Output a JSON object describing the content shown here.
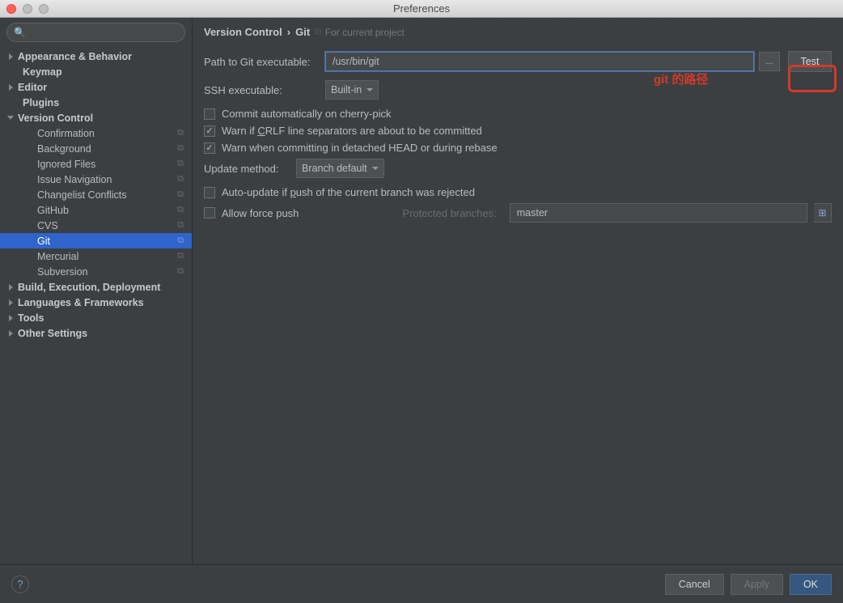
{
  "window": {
    "title": "Preferences"
  },
  "search": {
    "placeholder": ""
  },
  "tree": {
    "items": [
      {
        "label": "Appearance & Behavior",
        "bold": true,
        "arrow": "right",
        "indent": 0
      },
      {
        "label": "Keymap",
        "bold": true,
        "indent": 1,
        "noarrow": true
      },
      {
        "label": "Editor",
        "bold": true,
        "arrow": "right",
        "indent": 0
      },
      {
        "label": "Plugins",
        "bold": true,
        "indent": 1,
        "noarrow": true
      },
      {
        "label": "Version Control",
        "bold": true,
        "arrow": "down",
        "indent": 0
      },
      {
        "label": "Confirmation",
        "indent": 2,
        "copy": true
      },
      {
        "label": "Background",
        "indent": 2,
        "copy": true
      },
      {
        "label": "Ignored Files",
        "indent": 2,
        "copy": true
      },
      {
        "label": "Issue Navigation",
        "indent": 2,
        "copy": true
      },
      {
        "label": "Changelist Conflicts",
        "indent": 2,
        "copy": true
      },
      {
        "label": "GitHub",
        "indent": 2,
        "copy": true
      },
      {
        "label": "CVS",
        "indent": 2,
        "copy": true
      },
      {
        "label": "Git",
        "indent": 2,
        "copy": true,
        "selected": true
      },
      {
        "label": "Mercurial",
        "indent": 2,
        "copy": true
      },
      {
        "label": "Subversion",
        "indent": 2,
        "copy": true
      },
      {
        "label": "Build, Execution, Deployment",
        "bold": true,
        "arrow": "right",
        "indent": 0
      },
      {
        "label": "Languages & Frameworks",
        "bold": true,
        "arrow": "right",
        "indent": 0
      },
      {
        "label": "Tools",
        "bold": true,
        "arrow": "right",
        "indent": 0
      },
      {
        "label": "Other Settings",
        "bold": true,
        "arrow": "right",
        "indent": 0
      }
    ]
  },
  "breadcrumb": {
    "root": "Version Control",
    "sep": "›",
    "leaf": "Git",
    "project": "For current project"
  },
  "form": {
    "path_label": "Path to Git executable:",
    "path_value": "/usr/bin/git",
    "browse": "...",
    "test": "Test",
    "ssh_label": "SSH executable:",
    "ssh_value": "Built-in",
    "cb_cherry": "Commit automatically on cherry-pick",
    "cb_crlf_pre": "Warn if ",
    "cb_crlf_u": "C",
    "cb_crlf_post": "RLF line separators are about to be committed",
    "cb_detached": "Warn when committing in detached HEAD or during rebase",
    "update_label": "Update method:",
    "update_value": "Branch default",
    "cb_autoupdate_pre": "Auto-update if ",
    "cb_autoupdate_u": "p",
    "cb_autoupdate_post": "ush of the current branch was rejected",
    "cb_force_pre": "Allow ",
    "cb_force_u": "f",
    "cb_force_post": "orce push",
    "protected_label": "Protected branches:",
    "protected_value": "master"
  },
  "annotation": "git 的路径",
  "footer": {
    "help": "?",
    "cancel": "Cancel",
    "apply": "Apply",
    "ok": "OK"
  }
}
